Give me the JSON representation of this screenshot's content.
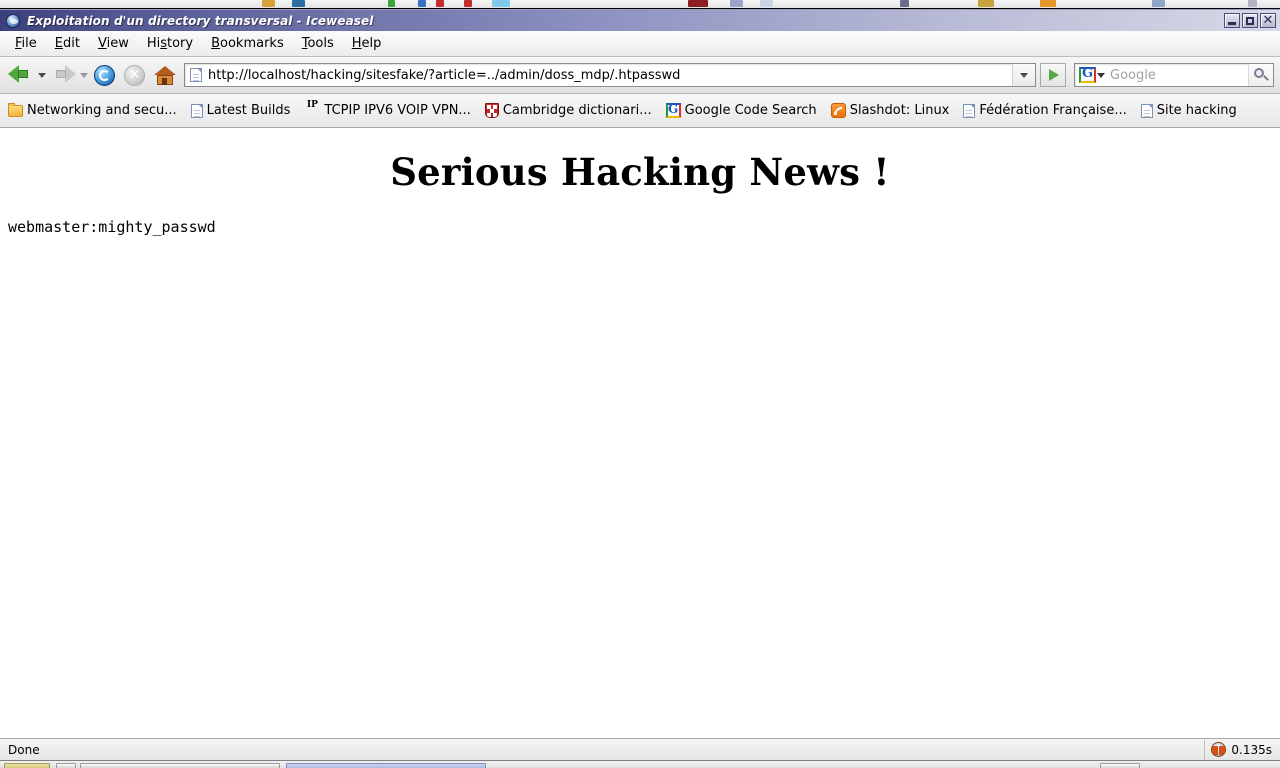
{
  "window": {
    "title": "Exploitation d'un directory transversal - Iceweasel",
    "app_icon": "iceweasel-globe-icon",
    "controls": {
      "minimize": "minimize-button",
      "maximize": "maximize-button",
      "close_glyph": "✕"
    }
  },
  "menubar": {
    "items": [
      {
        "mnemonic": "F",
        "rest": "ile"
      },
      {
        "mnemonic": "E",
        "rest": "dit"
      },
      {
        "mnemonic": "V",
        "rest": "iew"
      },
      {
        "pre": "Hi",
        "mnemonic": "s",
        "rest": "tory"
      },
      {
        "mnemonic": "B",
        "rest": "ookmarks"
      },
      {
        "mnemonic": "T",
        "rest": "ools"
      },
      {
        "mnemonic": "H",
        "rest": "elp"
      }
    ]
  },
  "navbar": {
    "back_label": "Back",
    "forward_label": "Forward",
    "reload_label": "Reload",
    "stop_label": "Stop",
    "stop_glyph": "✕",
    "home_label": "Home",
    "url": "http://localhost/hacking/sitesfake/?article=../admin/doss_mdp/.htpasswd",
    "go_label": "Go"
  },
  "search": {
    "engine": "Google",
    "engine_glyph": "G",
    "placeholder": "Google",
    "value": ""
  },
  "bookmarks": [
    {
      "label": "Networking and secu...",
      "icon": "folder-icon",
      "icon_type": "folder"
    },
    {
      "label": "Latest Builds",
      "icon": "page-icon",
      "icon_type": "page"
    },
    {
      "label": "TCPIP IPV6 VOIP VPN...",
      "icon": "ip-text-icon",
      "icon_type": "ip",
      "icon_text": "IP"
    },
    {
      "label": "Cambridge dictionari...",
      "icon": "shield-icon",
      "icon_type": "shield"
    },
    {
      "label": "Google Code Search",
      "icon": "google-g-icon",
      "icon_type": "glogo"
    },
    {
      "label": "Slashdot: Linux",
      "icon": "rss-feed-icon",
      "icon_type": "rss"
    },
    {
      "label": "Fédération Française...",
      "icon": "page-icon",
      "icon_type": "page"
    },
    {
      "label": "Site hacking",
      "icon": "page-icon",
      "icon_type": "page"
    }
  ],
  "page": {
    "heading": "Serious Hacking News !",
    "body_text": "webmaster:mighty_passwd"
  },
  "statusbar": {
    "status": "Done",
    "load_time": "0.135s",
    "timer_icon": "page-load-timer-icon"
  },
  "colors": {
    "titlebar_start": "#3b3f7a",
    "titlebar_end": "#d7d8e6",
    "back_arrow_green": "#4fa83d",
    "reload_blue": "#0a4f9c",
    "rss_orange": "#e8730a",
    "page_background": "#ffffff"
  }
}
